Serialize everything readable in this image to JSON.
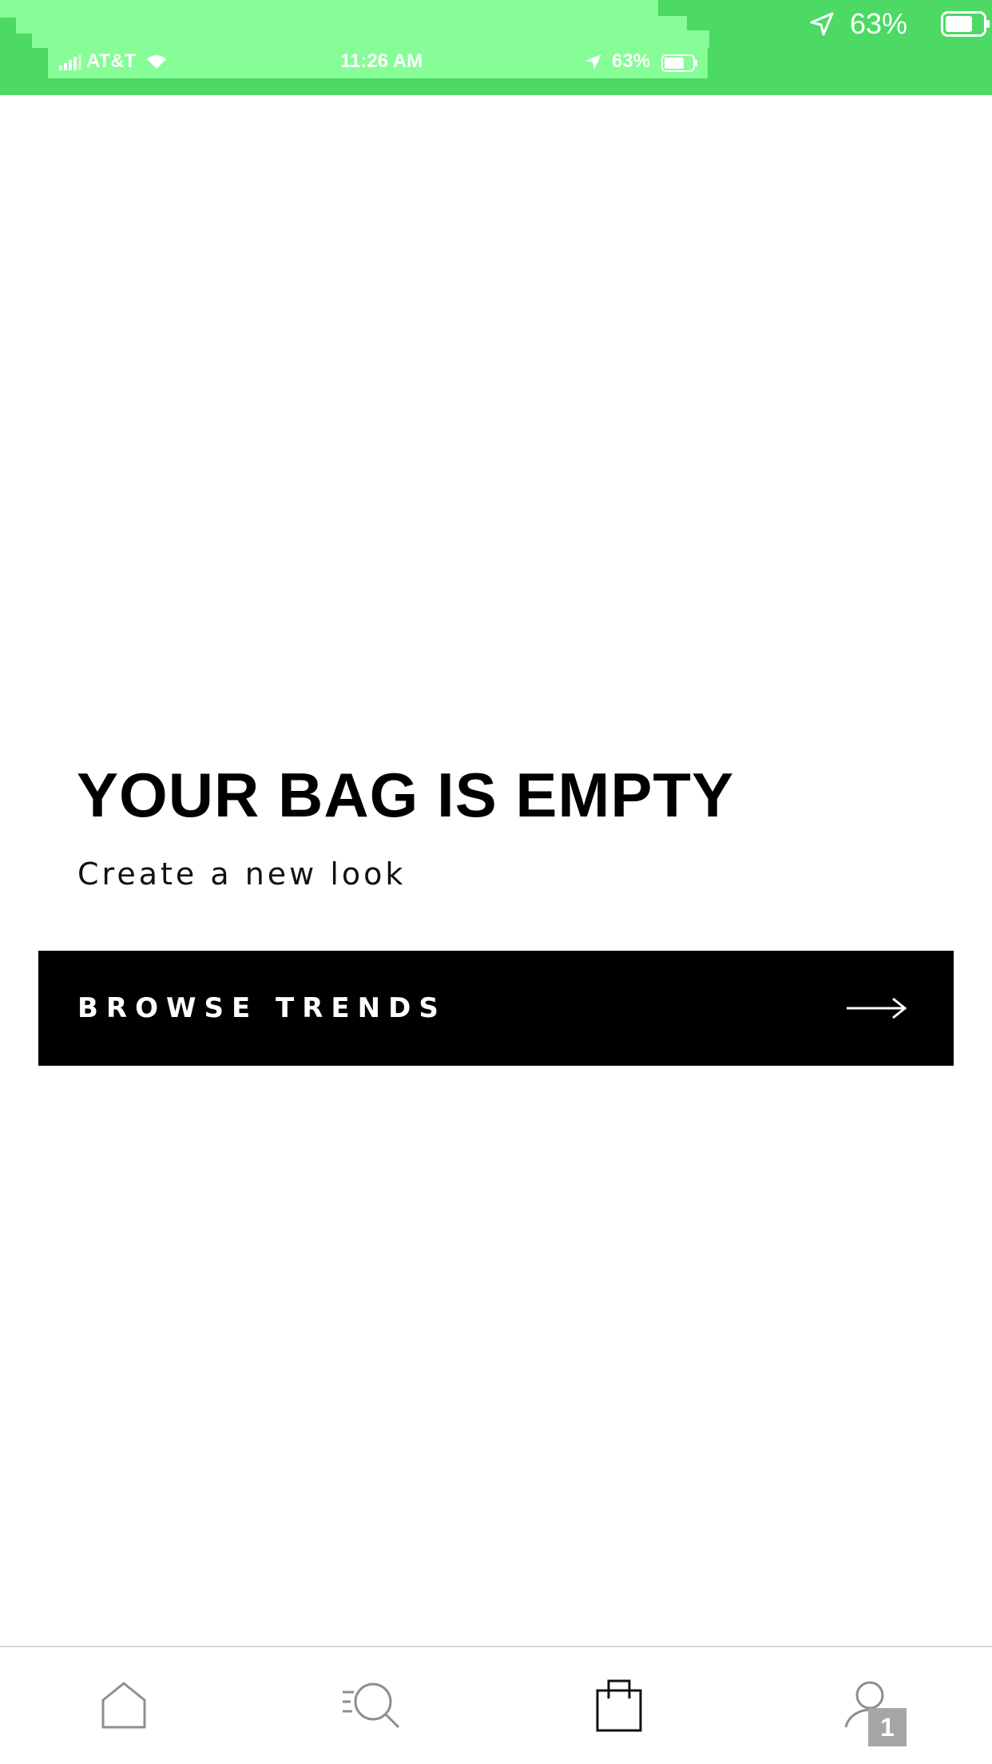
{
  "status_bar": {
    "carrier": "AT&T",
    "time": "11:26 AM",
    "battery_percent": "63%",
    "background_color": "#4cd964"
  },
  "empty_state": {
    "title": "YOUR BAG IS EMPTY",
    "subtitle": "Create a new look",
    "button_label": "BROWSE TRENDS"
  },
  "tab_bar": {
    "tabs": [
      {
        "icon": "home-icon",
        "active": false
      },
      {
        "icon": "search-icon",
        "active": false
      },
      {
        "icon": "bag-icon",
        "active": true
      },
      {
        "icon": "profile-icon",
        "active": false
      }
    ],
    "profile_badge": "1"
  }
}
